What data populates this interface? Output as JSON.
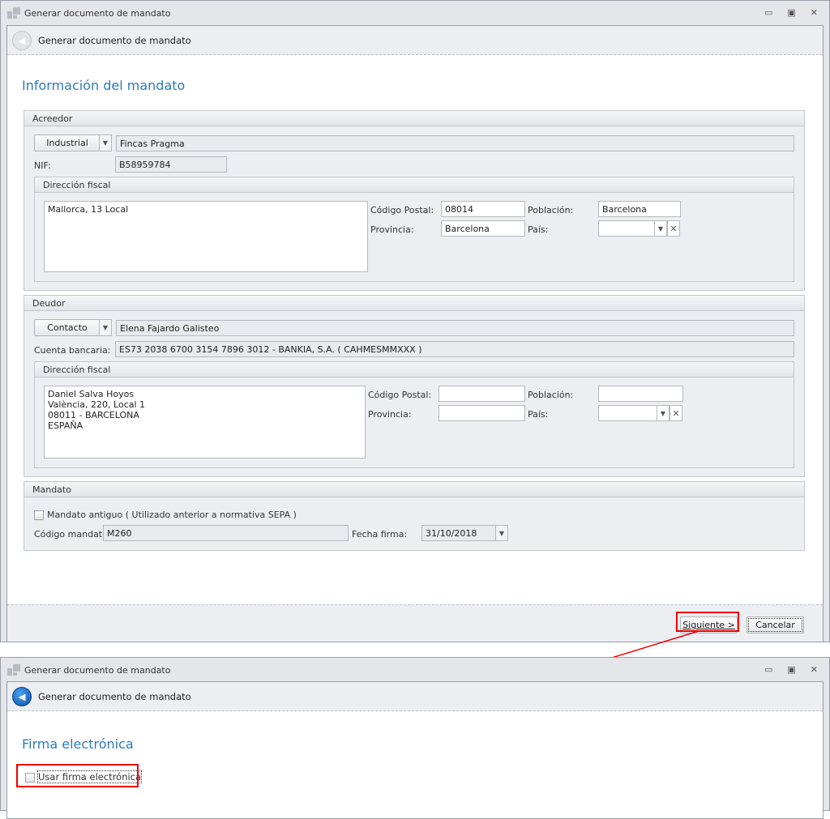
{
  "window_title": "Generar documento de mandato",
  "header_title": "Generar documento de mandato",
  "page_title": "Información del mandato",
  "acreedor": {
    "title": "Acreedor",
    "type": "Industrial",
    "name": "Fincas Pragma",
    "nif_label": "NIF:",
    "nif": "B58959784",
    "direccion": {
      "title": "Dirección fiscal",
      "address": "Mallorca, 13 Local",
      "cp_label": "Código Postal:",
      "cp": "08014",
      "poblacion_label": "Población:",
      "poblacion": "Barcelona",
      "provincia_label": "Provincia:",
      "provincia": "Barcelona",
      "pais_label": "País:",
      "pais": ""
    }
  },
  "deudor": {
    "title": "Deudor",
    "type": "Contacto",
    "name": "Elena Fajardo Galisteo",
    "cuenta_label": "Cuenta bancaria:",
    "cuenta": "ES73 2038 6700 3154 7896 3012 - BANKIA, S.A. ( CAHMESMMXXX )",
    "direccion": {
      "title": "Dirección fiscal",
      "address": "Daniel Salva Hoyos\nValència, 220, Local 1\n08011 - BARCELONA\nESPAÑA",
      "cp_label": "Código Postal:",
      "cp": "",
      "poblacion_label": "Población:",
      "poblacion": "",
      "provincia_label": "Provincia:",
      "provincia": "",
      "pais_label": "País:",
      "pais": ""
    }
  },
  "mandato": {
    "title": "Mandato",
    "antiguo_label": "Mandato antiguo ( Utilizado anterior a normativa SEPA )",
    "codigo_label": "Código mandato:",
    "codigo": "M260",
    "fecha_label": "Fecha firma:",
    "fecha": "31/10/2018"
  },
  "buttons": {
    "next": "Siguiente >",
    "cancel": "Cancelar"
  },
  "step2": {
    "window_title": "Generar documento de mandato",
    "header_title": "Generar documento de mandato",
    "page_title": "Firma electrónica",
    "checkbox_label": "Usar firma electrónica"
  },
  "colors": {
    "accent": "#2b7bbd",
    "highlight": "#e00000"
  }
}
